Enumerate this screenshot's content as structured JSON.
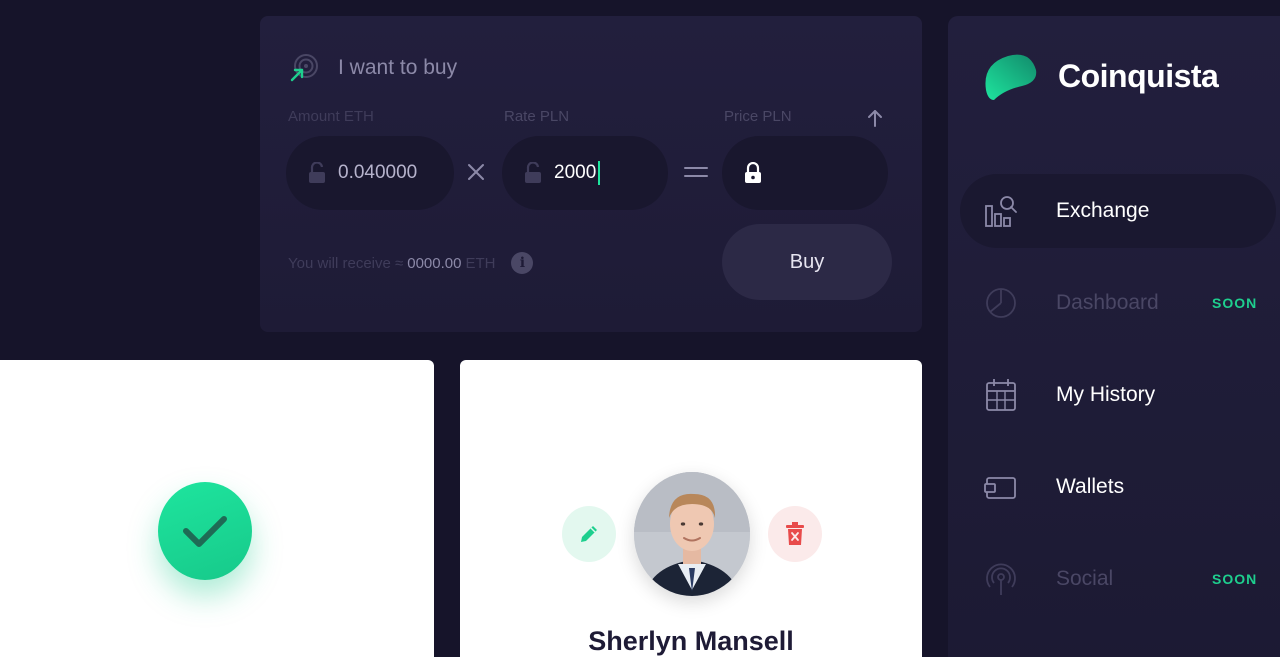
{
  "buy_form": {
    "title": "I want to buy",
    "amount_label": "Amount ETH",
    "amount_value": "0.040000",
    "rate_label": "Rate PLN",
    "rate_value": "2000",
    "price_label": "Price PLN",
    "receive_prefix": "You will receive ≈",
    "receive_amount": "0000.00",
    "receive_unit": "ETH",
    "info_glyph": "i",
    "buy_label": "Buy"
  },
  "profile_card": {
    "name": "Sherlyn Mansell"
  },
  "sidebar": {
    "brand": "Coinquista",
    "items": [
      {
        "label": "Exchange",
        "icon": "exchange-icon",
        "active": true,
        "badge": ""
      },
      {
        "label": "Dashboard",
        "icon": "pie-chart-icon",
        "active": false,
        "badge": "SOON"
      },
      {
        "label": "My History",
        "icon": "calendar-icon",
        "active": false,
        "badge": ""
      },
      {
        "label": "Wallets",
        "icon": "wallet-icon",
        "active": false,
        "badge": ""
      },
      {
        "label": "Social",
        "icon": "broadcast-icon",
        "active": false,
        "badge": "SOON"
      }
    ]
  },
  "colors": {
    "background": "#16142a",
    "panel": "#221f3d",
    "accent_green": "#1ee59e",
    "danger_red": "#e84b4b"
  }
}
